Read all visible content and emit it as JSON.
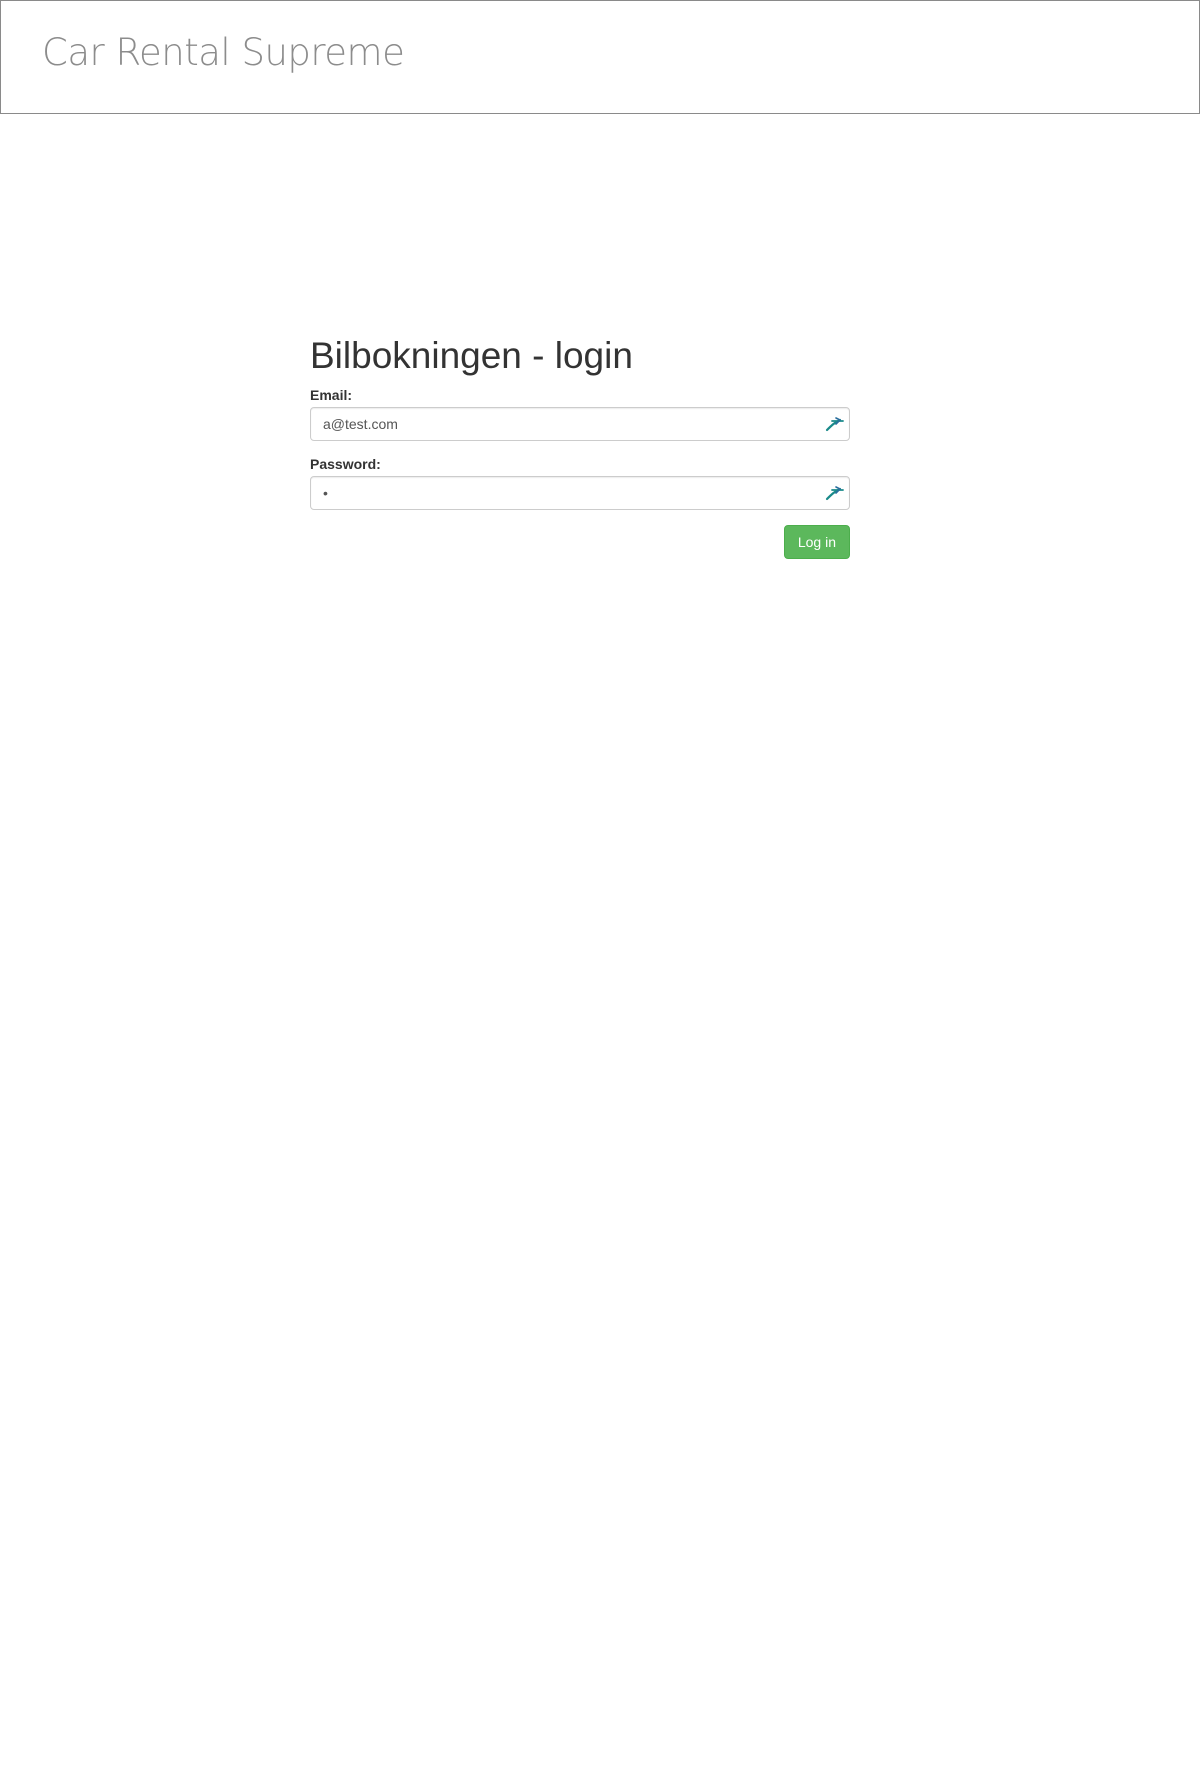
{
  "navbar": {
    "brand": "Car Rental Supreme"
  },
  "login": {
    "title": "Bilbokningen - login",
    "email": {
      "label": "Email:",
      "value": "a@test.com",
      "icon": "autofill-key-icon"
    },
    "password": {
      "label": "Password:",
      "value": "•",
      "icon": "autofill-key-icon"
    },
    "submit_label": "Log in"
  },
  "colors": {
    "brand_text": "#8c8c8c",
    "button_bg": "#5cb85c",
    "autofill_icon": "#1a8a8a"
  }
}
